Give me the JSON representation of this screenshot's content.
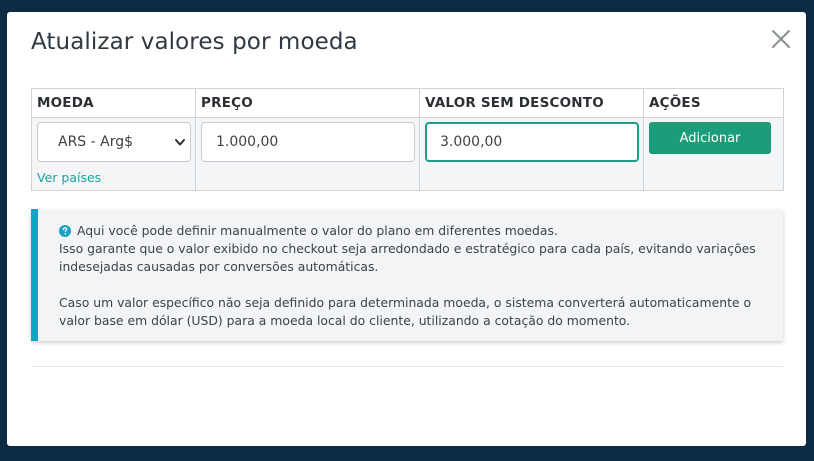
{
  "modal": {
    "title": "Atualizar valores por moeda",
    "close_icon": "close-icon"
  },
  "table": {
    "headers": [
      "MOEDA",
      "PREÇO",
      "VALOR SEM DESCONTO",
      "AÇÕES"
    ],
    "row": {
      "currency_selected": "ARS - Arg$",
      "countries_link": "Ver países",
      "price": "1.000,00",
      "value_without_discount": "3.000,00",
      "add_button": "Adicionar"
    }
  },
  "info": {
    "icon": "question-circle-icon",
    "line1": "Aqui você pode definir manualmente o valor do plano em diferentes moedas.",
    "line2": "Isso garante que o valor exibido no checkout seja arredondado e estratégico para cada país, evitando variações indesejadas causadas por conversões automáticas.",
    "line3": "Caso um valor específico não seja definido para determinada moeda, o sistema converterá automaticamente o valor base em dólar (USD) para a moeda local do cliente, utilizando a cotação do momento."
  },
  "colors": {
    "backdrop": "#0c2b45",
    "primary_button": "#1c9c78",
    "focus_border": "#1d9e8a",
    "info_accent": "#17a2c5",
    "link": "#18a3a3"
  }
}
